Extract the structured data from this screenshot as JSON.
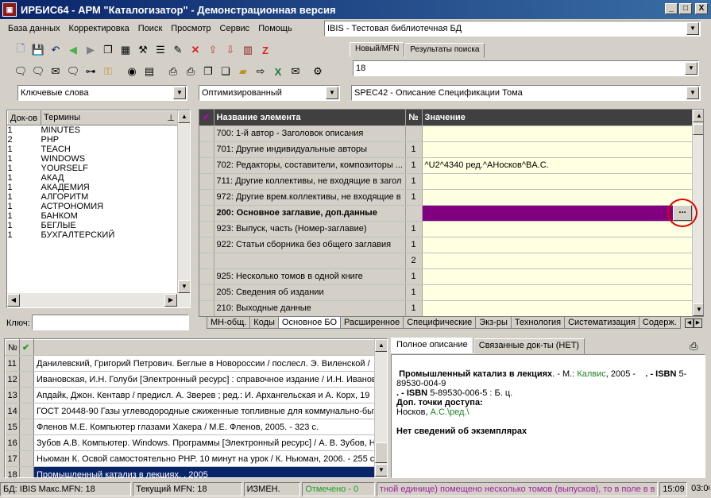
{
  "window": {
    "title": "ИРБИС64 - АРМ \"Каталогизатор\" - Демонстрационная версия",
    "min": "_",
    "max": "□",
    "close": "X"
  },
  "menu": [
    "База данных",
    "Корректировка",
    "Поиск",
    "Просмотр",
    "Сервис",
    "Помощь"
  ],
  "db_combo": {
    "value": "IBIS - Тестовая библиотечная БД"
  },
  "top_tabs": [
    {
      "label": "Новый/MFN",
      "active": true
    },
    {
      "label": "Результаты поиска",
      "active": false
    }
  ],
  "mfn_combo": {
    "value": "18"
  },
  "toolbar1_icons": [
    "new-doc-icon",
    "save-icon",
    "undo-icon",
    "back-icon",
    "forward-icon",
    "copy-icon",
    "table-icon",
    "tools-icon",
    "list-icon",
    "edit-icon",
    "delete-icon",
    "export-icon",
    "import-icon",
    "book-icon",
    "z-icon"
  ],
  "toolbar2_icons": [
    "comment-icon",
    "comment2-icon",
    "mail-icon",
    "comment3-icon",
    "tree-icon",
    "key-icon",
    "view-icon",
    "folder-icon",
    "print-icon",
    "print2-icon",
    "copy2-icon",
    "paste-icon",
    "folder2-icon",
    "export2-icon",
    "excel-icon",
    "mail2-icon",
    "settings-icon"
  ],
  "search_mode_combo": {
    "value": "Ключевые слова"
  },
  "optimization_combo": {
    "value": "Оптимизированный"
  },
  "worksheet_combo": {
    "value": "SPEC42 - Описание Спецификации Тома"
  },
  "terms": {
    "headers": {
      "docs": "Док-ов",
      "terms": "Термины"
    },
    "rows": [
      {
        "docs": "1",
        "term": "MINUTES",
        "selected": true
      },
      {
        "docs": "2",
        "term": "PHP"
      },
      {
        "docs": "1",
        "term": "TEACH"
      },
      {
        "docs": "1",
        "term": "WINDOWS"
      },
      {
        "docs": "1",
        "term": "YOURSELF"
      },
      {
        "docs": "1",
        "term": "АКАД"
      },
      {
        "docs": "1",
        "term": "АКАДЕМИЯ"
      },
      {
        "docs": "1",
        "term": "АЛГОРИТМ"
      },
      {
        "docs": "1",
        "term": "АСТРОНОМИЯ"
      },
      {
        "docs": "1",
        "term": "БАНКОМ"
      },
      {
        "docs": "1",
        "term": "БЕГЛЫЕ"
      },
      {
        "docs": "1",
        "term": "БУХГАЛТЕРСКИЙ"
      }
    ],
    "key_label": "Ключ:",
    "key_value": ""
  },
  "grid": {
    "headers": {
      "check": "✔",
      "name": "Название элемента",
      "no": "№",
      "value": "Значение"
    },
    "rows": [
      {
        "name": "700: 1-й автор - Заголовок описания",
        "no": "",
        "value": ""
      },
      {
        "name": "701: Другие индивидуальные авторы",
        "no": "1",
        "value": ""
      },
      {
        "name": "702: Редакторы, составители, композиторы ...",
        "no": "1",
        "value": "^U2^4340 ред.^AНосков^BА.С."
      },
      {
        "name": "711: Другие коллективы, не входящие в загол",
        "no": "1",
        "value": ""
      },
      {
        "name": "972: Другие врем.коллективы, не входящие в",
        "no": "1",
        "value": ""
      },
      {
        "name": "200: Основное заглавие, доп.данные",
        "no": "",
        "value": "",
        "bold": true
      },
      {
        "name": "923: Выпуск, часть (Номер-заглавие)",
        "no": "1",
        "value": ""
      },
      {
        "name": "922: Статьи сборника без общего заглавия",
        "no": "1",
        "value": ""
      },
      {
        "name": "",
        "no": "2",
        "value": ""
      },
      {
        "name": "925: Несколько томов в одной книге",
        "no": "1",
        "value": ""
      },
      {
        "name": "205: Сведения об издании",
        "no": "1",
        "value": ""
      },
      {
        "name": "210: Выходные данные",
        "no": "1",
        "value": ""
      }
    ],
    "ellipsis": "...",
    "highlight_color": "#800080",
    "tabs": [
      "МН-общ.",
      "Коды",
      "Основное БО",
      "Расширенное",
      "Специфические",
      "Экз-ры",
      "Технология",
      "Систематизация",
      "Содерж."
    ],
    "active_tab": 2
  },
  "records": {
    "headers": {
      "no": "№",
      "check": "✔"
    },
    "rows": [
      {
        "no": "11",
        "text": "Данилевский, Григорий Петрович. Беглые в Новороссии / послесл. Э. Виленской /"
      },
      {
        "no": "12",
        "text": "Ивановская, И.Н. Голуби [Электронный ресурс] : справочное издание / И.Н. Иванов"
      },
      {
        "no": "13",
        "text": "Апдайк, Джон. Кентавр / предисл. А. Зверев ; ред.: И. Архангельская и А. Корх, 19"
      },
      {
        "no": "14",
        "text": "ГОСТ 20448-90 Газы углеводородные сжиженные топливные для коммунально-быт"
      },
      {
        "no": "15",
        "text": "Фленов М.Е. Компьютер глазами Хакера / М.Е. Фленов, 2005. - 323 с."
      },
      {
        "no": "16",
        "text": "Зубов А.В. Компьютер. Windows. Программы [Электронный ресурс] / А. В. Зубов, Н"
      },
      {
        "no": "17",
        "text": "Ньюман К. Освой самостоятельно PHP. 10 минут на урок / К. Ньюман, 2006. - 255 с"
      },
      {
        "no": "18",
        "text": "Промышленный катализ в лекциях. , 2005",
        "selected": true
      }
    ]
  },
  "detail": {
    "tabs": [
      {
        "label": "Полное описание",
        "active": true
      },
      {
        "label": "Связанные док-ты (НЕТ)",
        "active": false
      }
    ],
    "line1_bold": "Промышленный катализ в лекциях",
    "line1_rest": ". - М.: ",
    "publisher": "Калвис",
    "line1_year": ", 2005 -",
    "isbn1_label": ". - ISBN",
    "isbn1": "5-89530-004-9",
    "isbn2_label": ". - ISBN",
    "isbn2": "5-89530-006-5 : Б. ц.",
    "access_label": "Доп. точки доступа:",
    "access_name": "Носков, ",
    "access_link": "А.С.\\ред.\\",
    "no_copies": "Нет сведений об экземплярах"
  },
  "status": {
    "db": "БД: IBIS Макс.MFN: 18",
    "current": "Текущий MFN: 18",
    "changed": "ИЗМЕН.",
    "marked": "Отмечено - 0",
    "message": "тной единице) помещено несколько томов (выпусков), то в поле в в",
    "time": "15:09",
    "clock2": "03:00"
  }
}
